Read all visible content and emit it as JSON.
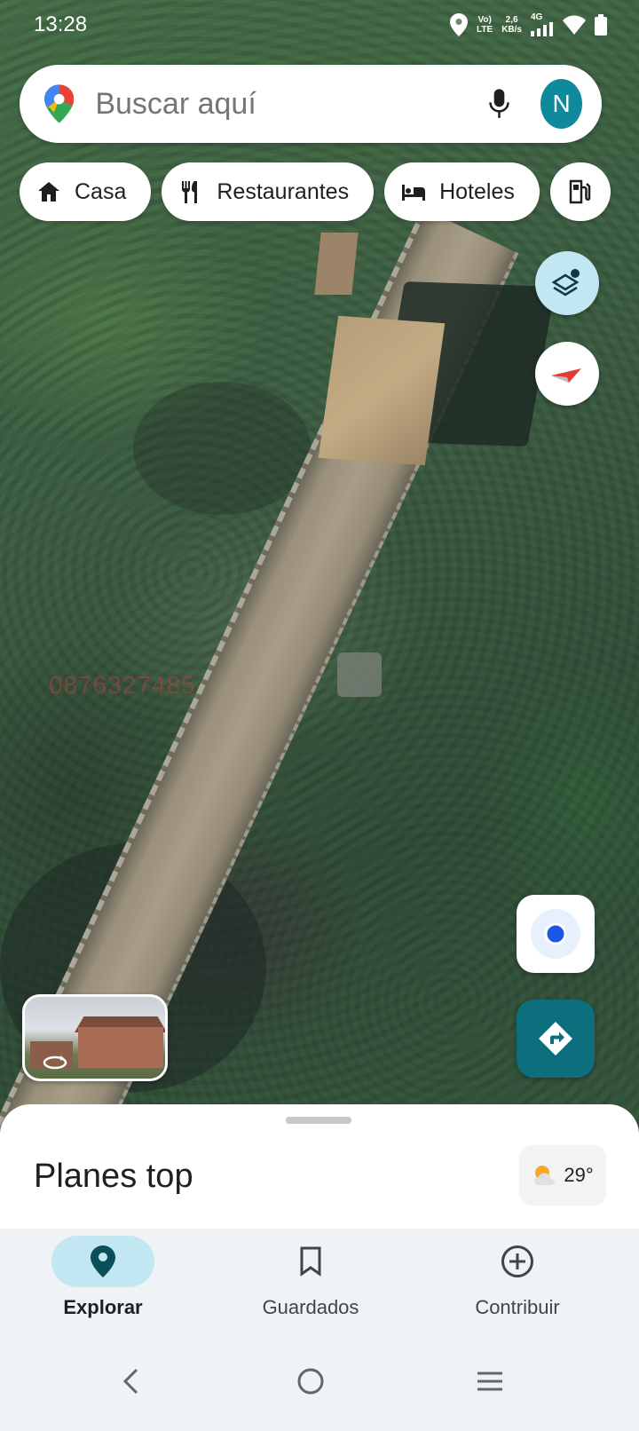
{
  "status_bar": {
    "time": "13:28",
    "network_label_top": "Vo)",
    "network_label_bottom": "LTE",
    "speed_value": "2,6",
    "speed_unit": "KB/s",
    "cell_label": "4G"
  },
  "search": {
    "placeholder": "Buscar aquí",
    "avatar_initial": "N"
  },
  "chips": [
    {
      "label": "Casa",
      "icon": "home-icon"
    },
    {
      "label": "Restaurantes",
      "icon": "restaurant-icon"
    },
    {
      "label": "Hoteles",
      "icon": "hotel-icon"
    },
    {
      "label": "",
      "icon": "gas-station-icon"
    }
  ],
  "map": {
    "watermark": "0876327485"
  },
  "sheet": {
    "title": "Planes top",
    "weather_temp": "29°"
  },
  "bottom_nav": {
    "items": [
      {
        "label": "Explorar",
        "icon": "explore-pin-icon",
        "active": true
      },
      {
        "label": "Guardados",
        "icon": "bookmark-icon",
        "active": false
      },
      {
        "label": "Contribuir",
        "icon": "add-circle-icon",
        "active": false
      }
    ]
  },
  "colors": {
    "accent_teal": "#0d6f7e",
    "avatar_bg": "#0f8a9c",
    "active_pill": "#c3e7f2",
    "location_dot": "#1a56e8"
  }
}
